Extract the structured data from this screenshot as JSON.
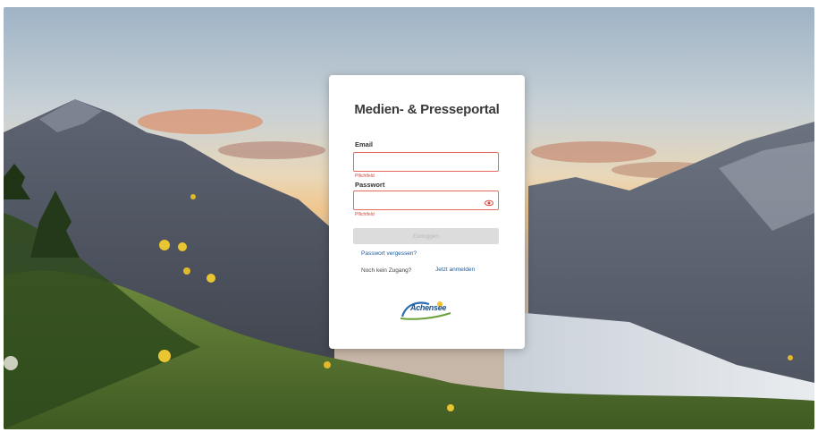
{
  "portal": {
    "title": "Medien- & Presseportal"
  },
  "form": {
    "email_label": "Email",
    "email_value": "",
    "email_error": "Pflichtfeld",
    "password_label": "Passwort",
    "password_value": "",
    "password_error": "Pflichtfeld",
    "login_button_label": "Einloggen",
    "forgot_password_link": "Passwort vergessen?",
    "no_access_text": "Noch kein Zugang?",
    "register_link": "Jetzt anmelden"
  },
  "logo": {
    "text": "Achensee",
    "icon": "achensee-logo"
  },
  "colors": {
    "error_border": "#e66a5f",
    "link": "#1f5a99",
    "button_disabled": "#dcdcdc"
  }
}
